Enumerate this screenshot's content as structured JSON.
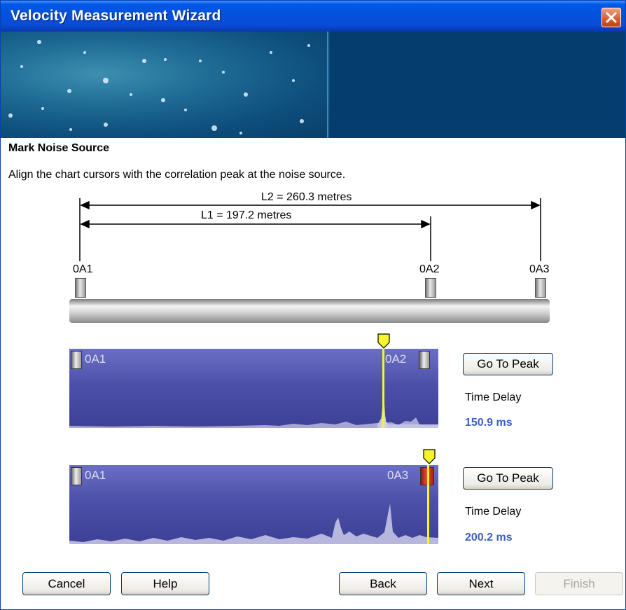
{
  "window": {
    "title": "Velocity Measurement Wizard",
    "close_icon": "close-icon"
  },
  "page": {
    "heading": "Mark Noise Source",
    "instructions": "Align the chart cursors with the correlation peak at the noise source."
  },
  "diagram": {
    "l2_label": "L2 = 260.3 metres",
    "l1_label": "L1 = 197.2 metres",
    "sensors": [
      "0A1",
      "0A2",
      "0A3"
    ]
  },
  "correlation_charts": [
    {
      "left_label": "0A1",
      "right_label": "0A2",
      "go_to_peak_label": "Go To Peak",
      "time_delay_label": "Time Delay",
      "time_delay_value": "150.9 ms"
    },
    {
      "left_label": "0A1",
      "right_label": "0A3",
      "go_to_peak_label": "Go To Peak",
      "time_delay_label": "Time Delay",
      "time_delay_value": "200.2 ms"
    }
  ],
  "buttons": {
    "cancel": "Cancel",
    "help": "Help",
    "back": "Back",
    "next": "Next",
    "finish": "Finish"
  },
  "colors": {
    "titlebar": "#0451db",
    "chart_background": "#4c50a8",
    "cursor": "#f5f52a",
    "time_delay_value": "#3a5fc0"
  }
}
